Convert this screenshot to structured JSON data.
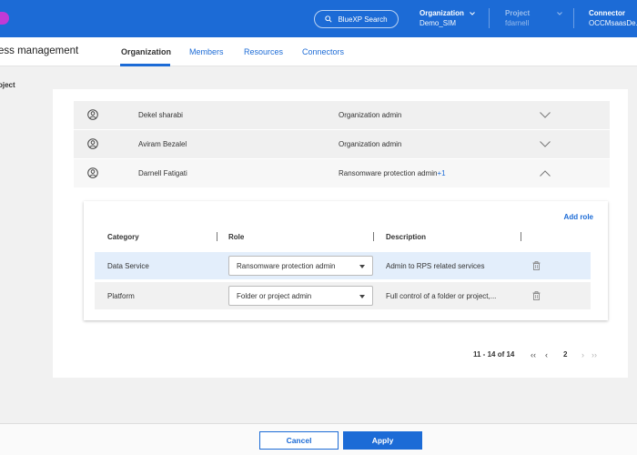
{
  "header": {
    "search_label": "BlueXP Search",
    "organization": {
      "label": "Organization",
      "value": "Demo_SIM"
    },
    "project": {
      "label": "Project",
      "value": "fdarnell"
    },
    "connector": {
      "label": "Connector",
      "value": "OCCMsaasDe..."
    },
    "accent": "#1c6bd6"
  },
  "subnav": {
    "title": "ess management",
    "tabs": [
      "Organization",
      "Members",
      "Resources",
      "Connectors"
    ],
    "active_tab": "Organization"
  },
  "side_label": "oject",
  "members": [
    {
      "name": "Dekel sharabi",
      "role": "Organization admin",
      "extra": ""
    },
    {
      "name": "Aviram Bezalel",
      "role": "Organization admin",
      "extra": ""
    },
    {
      "name": "Darnell Fatigati",
      "role": "Ransomware protection admin",
      "extra": "+1"
    }
  ],
  "detail": {
    "add_role_label": "Add role",
    "columns": [
      "Category",
      "Role",
      "Description"
    ],
    "rows": [
      {
        "category": "Data Service",
        "role": "Ransomware protection admin",
        "description": "Admin to RPS related services"
      },
      {
        "category": "Platform",
        "role": "Folder or project admin",
        "description": "Full control of a folder or project,..."
      }
    ]
  },
  "pagination": {
    "range": "11 - 14 of 14",
    "page": "2"
  },
  "footer": {
    "cancel_label": "Cancel",
    "apply_label": "Apply"
  }
}
